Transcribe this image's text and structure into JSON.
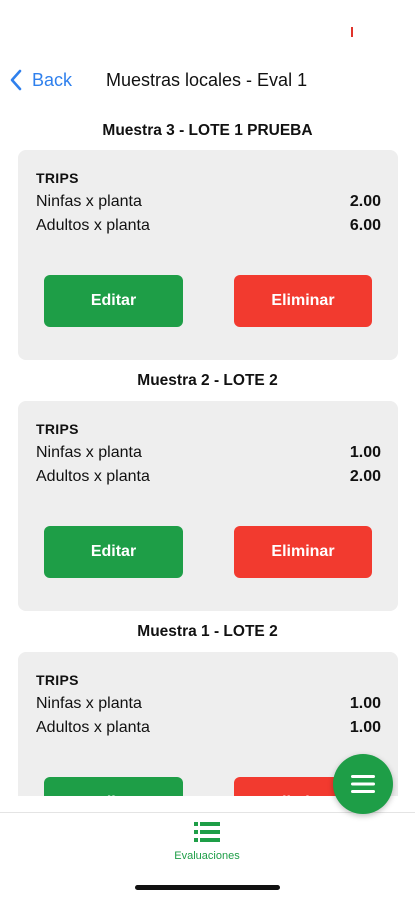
{
  "nav": {
    "back_label": "Back",
    "title": "Muestras locales - Eval 1"
  },
  "samples": [
    {
      "title": "Muestra 3 - LOTE 1 PRUEBA",
      "pest": "TRIPS",
      "rows": [
        {
          "label": "Ninfas x planta",
          "value": "2.00"
        },
        {
          "label": "Adultos x planta",
          "value": "6.00"
        }
      ],
      "edit_label": "Editar",
      "delete_label": "Eliminar"
    },
    {
      "title": "Muestra 2 - LOTE 2",
      "pest": "TRIPS",
      "rows": [
        {
          "label": "Ninfas x planta",
          "value": "1.00"
        },
        {
          "label": "Adultos x planta",
          "value": "2.00"
        }
      ],
      "edit_label": "Editar",
      "delete_label": "Eliminar"
    },
    {
      "title": "Muestra 1 - LOTE 2",
      "pest": "TRIPS",
      "rows": [
        {
          "label": "Ninfas x planta",
          "value": "1.00"
        },
        {
          "label": "Adultos x planta",
          "value": "1.00"
        }
      ],
      "edit_label": "Editar",
      "delete_label": "Eliminar"
    }
  ],
  "tabbar": {
    "items": [
      {
        "label": "Evaluaciones",
        "icon": "list-icon",
        "active": true
      }
    ]
  },
  "fab": {
    "icon": "menu-icon"
  },
  "colors": {
    "accent_green": "#1e9e47",
    "danger_red": "#f23a2f",
    "link_blue": "#2f80ed",
    "card_bg": "#eeeeee"
  }
}
